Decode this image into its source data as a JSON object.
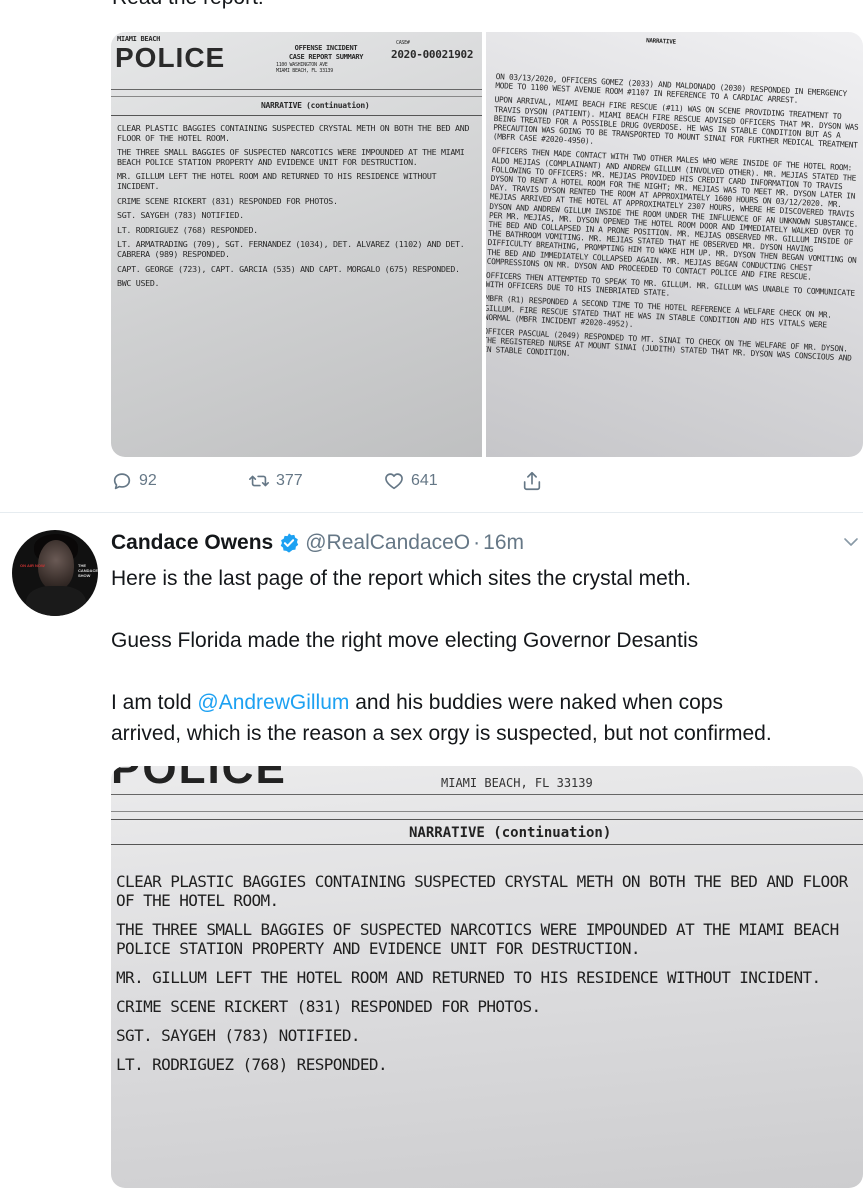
{
  "top_text": "Read the report:",
  "first_tweet": {
    "photo_left": {
      "dept": "MIAMI BEACH",
      "logo": "POLICE",
      "title_lines": [
        "OFFENSE INCIDENT",
        "CASE REPORT SUMMARY"
      ],
      "address_lines": [
        "1100 WASHINGTON AVE",
        "MIAMI BEACH, FL 33139"
      ],
      "case_label": "CASE#",
      "case_number": "2020-00021902",
      "narrative_header": "NARRATIVE (continuation)",
      "lines": [
        "CLEAR PLASTIC BAGGIES CONTAINING SUSPECTED CRYSTAL METH ON BOTH THE BED AND FLOOR OF THE HOTEL ROOM.",
        "THE THREE SMALL BAGGIES OF SUSPECTED NARCOTICS WERE IMPOUNDED AT THE MIAMI BEACH POLICE STATION PROPERTY AND EVIDENCE UNIT FOR DESTRUCTION.",
        "MR. GILLUM LEFT THE HOTEL ROOM AND RETURNED TO HIS RESIDENCE WITHOUT INCIDENT.",
        "CRIME SCENE RICKERT (831) RESPONDED FOR PHOTOS.",
        "SGT. SAYGEH (783) NOTIFIED.",
        "LT. RODRIGUEZ (768) RESPONDED.",
        "LT. ARMATRADING (709), SGT. FERNANDEZ (1034), DET. ALVAREZ (1102) AND DET. CABRERA (989) RESPONDED.",
        "CAPT. GEORGE (723), CAPT. GARCIA (535) AND CAPT. MORGALO (675) RESPONDED.",
        "BWC USED."
      ]
    },
    "photo_right": {
      "header": "NARRATIVE",
      "lines": [
        "ON 03/13/2020, OFFICERS GOMEZ (2033) AND MALDONADO (2030) RESPONDED IN EMERGENCY MODE TO 1100 WEST AVENUE ROOM #1107 IN REFERENCE TO A CARDIAC ARREST.",
        "UPON ARRIVAL, MIAMI BEACH FIRE RESCUE (#11) WAS ON SCENE PROVIDING TREATMENT TO TRAVIS DYSON (PATIENT). MIAMI BEACH FIRE RESCUE ADVISED OFFICERS THAT MR. DYSON WAS BEING TREATED FOR A POSSIBLE DRUG OVERDOSE. HE WAS IN STABLE CONDITION BUT AS A PRECAUTION WAS GOING TO BE TRANSPORTED TO MOUNT SINAI FOR FURTHER MEDICAL TREATMENT (MBFR CASE #2020-4950).",
        "OFFICERS THEN MADE CONTACT WITH TWO OTHER MALES WHO WERE INSIDE OF THE HOTEL ROOM: ALDO MEJIAS (COMPLAINANT) AND ANDREW GILLUM (INVOLVED OTHER). MR. MEJIAS STATED THE FOLLOWING TO OFFICERS: MR. MEJIAS PROVIDED HIS CREDIT CARD INFORMATION TO TRAVIS DYSON TO RENT A HOTEL ROOM FOR THE NIGHT; MR. MEJIAS WAS TO MEET MR. DYSON LATER IN DAY. TRAVIS DYSON RENTED THE ROOM AT APPROXIMATELY 1600 HOURS ON 03/12/2020. MR. MEJIAS ARRIVED AT THE HOTEL AT APPROXIMATELY 2307 HOURS, WHERE HE DISCOVERED TRAVIS DYSON AND ANDREW GILLUM INSIDE THE ROOM UNDER THE INFLUENCE OF AN UNKNOWN SUBSTANCE. PER MR. MEJIAS, MR. DYSON OPENED THE HOTEL ROOM DOOR AND IMMEDIATELY WALKED OVER TO THE BED AND COLLAPSED IN A PRONE POSITION. MR. MEJIAS OBSERVED MR. GILLUM INSIDE OF THE BATHROOM VOMITING. MR. MEJIAS STATED THAT HE OBSERVED MR. DYSON HAVING DIFFICULTY BREATHING, PROMPTING HIM TO WAKE HIM UP. MR. DYSON THEN BEGAN VOMITING ON THE BED AND IMMEDIATELY COLLAPSED AGAIN. MR. MEJIAS BEGAN CONDUCTING CHEST COMPRESSIONS ON MR. DYSON AND PROCEEDED TO CONTACT POLICE AND FIRE RESCUE.",
        "OFFICERS THEN ATTEMPTED TO SPEAK TO MR. GILLUM. MR. GILLUM WAS UNABLE TO COMMUNICATE WITH OFFICERS DUE TO HIS INEBRIATED STATE.",
        "MBFR (R1) RESPONDED A SECOND TIME TO THE HOTEL REFERENCE A WELFARE CHECK ON MR. GILLUM. FIRE RESCUE STATED THAT HE WAS IN STABLE CONDITION AND HIS VITALS WERE NORMAL (MBFR INCIDENT #2020-4952).",
        "OFFICER PASCUAL (2049) RESPONDED TO MT. SINAI TO CHECK ON THE WELFARE OF MR. DYSON. THE REGISTERED NURSE AT MOUNT SINAI (JUDITH) STATED THAT MR. DYSON WAS CONSCIOUS AND IN STABLE CONDITION."
      ]
    },
    "actions": {
      "reply_count": "92",
      "retweet_count": "377",
      "like_count": "641"
    }
  },
  "second_tweet": {
    "display_name": "Candace Owens",
    "handle": "@RealCandaceO",
    "separator": "·",
    "time": "16m",
    "avatar_left_text": "ON AIR NOW",
    "avatar_right_text": "THE CANDACE SHOW",
    "text": {
      "line1": "Here is the last page of the report which sites the crystal meth.",
      "line2": "Guess Florida made the right move electing Governor Desantis",
      "line3_pre": "I am told ",
      "line3_mention": "@AndrewGillum",
      "line3_post": " and his buddies were naked when cops",
      "line4": "arrived, which is the reason a sex orgy is suspected, but not confirmed."
    },
    "photo": {
      "logo": "POLICE",
      "address": "MIAMI BEACH, FL 33139",
      "narrative_header": "NARRATIVE (continuation)",
      "lines": [
        "CLEAR PLASTIC BAGGIES CONTAINING SUSPECTED CRYSTAL METH ON BOTH THE BED AND FLOOR OF THE HOTEL ROOM.",
        "THE THREE SMALL BAGGIES OF SUSPECTED NARCOTICS WERE IMPOUNDED AT THE MIAMI BEACH POLICE STATION PROPERTY AND EVIDENCE UNIT FOR DESTRUCTION.",
        "MR. GILLUM LEFT THE HOTEL ROOM AND RETURNED TO HIS RESIDENCE WITHOUT INCIDENT.",
        "CRIME SCENE RICKERT (831) RESPONDED FOR PHOTOS.",
        "SGT. SAYGEH (783) NOTIFIED.",
        "LT. RODRIGUEZ (768) RESPONDED."
      ]
    }
  },
  "colors": {
    "text": "#14171a",
    "muted": "#657786",
    "link": "#1da1f2",
    "divider": "#e6ecf0"
  }
}
